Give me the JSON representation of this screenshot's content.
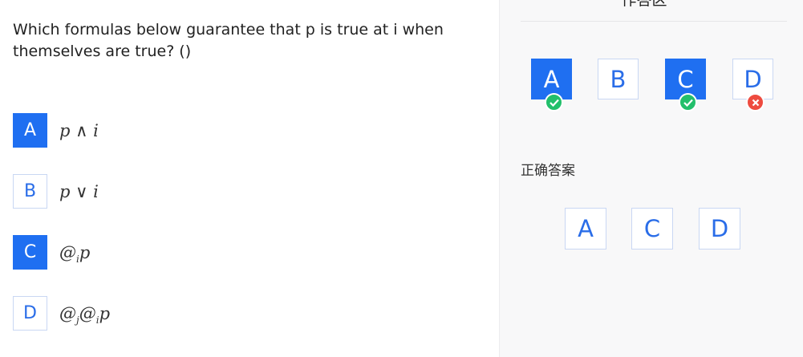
{
  "question": {
    "text": "Which formulas below guarantee that p is true at i when themselves are true? ()"
  },
  "options": [
    {
      "letter": "A",
      "formula": "p ∧ i",
      "selected": true
    },
    {
      "letter": "B",
      "formula": "p ∨ i",
      "selected": false
    },
    {
      "letter": "C",
      "formula_at": "@",
      "formula_sub": "i",
      "formula_p": "p",
      "selected": true
    },
    {
      "letter": "D",
      "formula_at1": "@",
      "formula_sub1": "j",
      "formula_at2": "@",
      "formula_sub2": "i",
      "formula_p": "p",
      "selected": false
    }
  ],
  "answer_panel": {
    "title": "作答区",
    "choices": [
      {
        "letter": "A",
        "selected": true,
        "status": "correct",
        "status_icon": "check-icon"
      },
      {
        "letter": "B",
        "selected": false
      },
      {
        "letter": "C",
        "selected": true,
        "status": "correct",
        "status_icon": "check-icon"
      },
      {
        "letter": "D",
        "selected": false,
        "status": "missed",
        "status_icon": "cross-icon"
      }
    ],
    "correct_label": "正确答案",
    "correct_answers": [
      "A",
      "C",
      "D"
    ]
  },
  "colors": {
    "accent": "#1f6ff1",
    "correct": "#22bf6b",
    "wrong": "#ee4b3f",
    "panel_bg": "#f8f8f9"
  }
}
